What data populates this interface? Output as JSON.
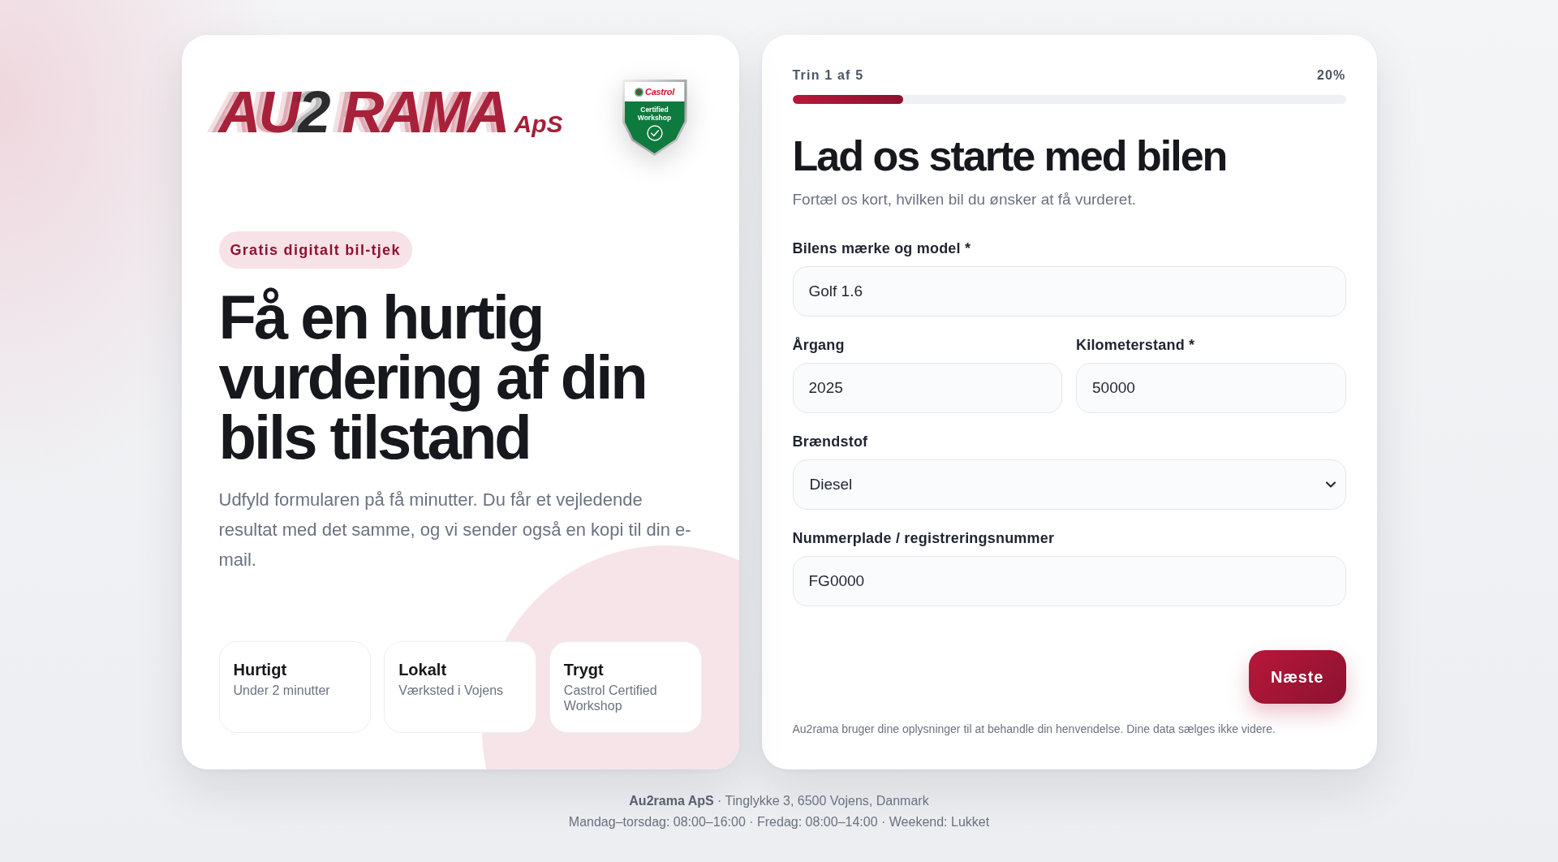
{
  "intro": {
    "logo": {
      "first": "AU",
      "digit": "2",
      "second": "RAMA",
      "suffix": "ApS"
    },
    "certificate": {
      "brand": "Castrol",
      "caption": "Certified Workshop"
    },
    "tag": "Gratis digitalt bil-tjek",
    "headline": "Få en hurtig vurdering af din bils tilstand",
    "description": "Udfyld formularen på få minutter. Du får et vejledende resultat med det samme, og vi sender også en kopi til din e-mail.",
    "features": [
      {
        "title": "Hurtigt",
        "text": "Under 2 minutter"
      },
      {
        "title": "Lokalt",
        "text": "Værksted i Vojens"
      },
      {
        "title": "Trygt",
        "text": "Castrol Certified Workshop"
      }
    ]
  },
  "form": {
    "step": "Trin 1 af 5",
    "percent": "20%",
    "progress": {
      "level": 0.2
    },
    "title": "Lad os starte med bilen",
    "subtitle": "Fortæl os kort, hvilken bil du ønsker at få vurderet.",
    "rows": [
      {
        "fields": [
          {
            "kind": "text",
            "label": "Bilens mærke og model *",
            "value": "Golf 1.6"
          }
        ]
      },
      {
        "fields": [
          {
            "kind": "text",
            "label": "Årgang",
            "value": "2025"
          },
          {
            "kind": "text",
            "label": "Kilometerstand *",
            "value": "50000"
          }
        ]
      },
      {
        "fields": [
          {
            "kind": "select",
            "label": "Brændstof",
            "value": "Diesel"
          }
        ]
      },
      {
        "fields": [
          {
            "kind": "text",
            "label": "Nummerplade / registreringsnummer",
            "value": "FG0000"
          }
        ]
      }
    ],
    "next_button": "Næste",
    "privacy_note": "Au2rama bruger dine oplysninger til at behandle din henvendelse. Dine data sælges ikke videre."
  },
  "footer": {
    "address": "**Au2rama ApS** · Tinglykke 3, 6500 Vojens, Danmark",
    "hours": "Mandag–torsdag: 08:00–16:00 · Fredag: 08:00–14:00 · Weekend: Lukket"
  }
}
